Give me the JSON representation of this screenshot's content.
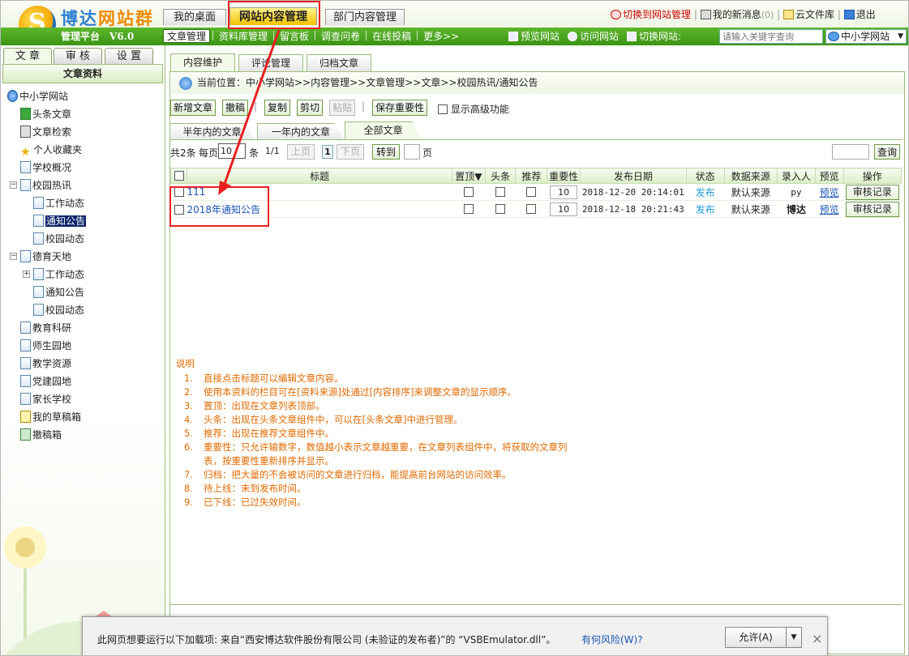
{
  "header": {
    "brand_a": "博达",
    "brand_b": "网站群",
    "platform": "管理平台",
    "version": "V6.0",
    "main_tabs": [
      {
        "label": "我的桌面"
      },
      {
        "label": "网站内容管理"
      },
      {
        "label": "部门内容管理"
      }
    ],
    "links": {
      "switch_manage": "切换到网站管理",
      "messages": "我的新消息",
      "message_count": "(0)",
      "cloud": "云文件库",
      "logout": "退出"
    }
  },
  "submenu": {
    "items": [
      "文章管理",
      "资料库管理",
      "留言板",
      "调查问卷",
      "在线投稿",
      "更多>>"
    ],
    "quick": [
      "预览网站",
      "访问网站",
      "切换网站:"
    ],
    "search_placeholder": "请输入关键字查询",
    "site_select": "中小学网站"
  },
  "left": {
    "tabs": [
      "文 章",
      "审 核",
      "设 置"
    ],
    "title": "文章资料",
    "tree": [
      {
        "label": "中小学网站"
      },
      {
        "label": "头条文章"
      },
      {
        "label": "文章检索"
      },
      {
        "label": "个人收藏夹"
      },
      {
        "label": "学校概况"
      },
      {
        "label": "校园热讯"
      },
      {
        "label": "工作动态"
      },
      {
        "label": "通知公告"
      },
      {
        "label": "校园动态"
      },
      {
        "label": "德育天地"
      },
      {
        "label": "工作动态"
      },
      {
        "label": "通知公告"
      },
      {
        "label": "校园动态"
      },
      {
        "label": "教育科研"
      },
      {
        "label": "师生园地"
      },
      {
        "label": "教学资源"
      },
      {
        "label": "党建园地"
      },
      {
        "label": "家长学校"
      },
      {
        "label": "我的草稿箱"
      },
      {
        "label": "撤稿箱"
      }
    ]
  },
  "content": {
    "tabs": [
      "内容维护",
      "评论管理",
      "归档文章"
    ],
    "breadcrumb": "当前位置：中小学网站>>内容管理>>文章管理>>文章>>校园热讯/通知公告",
    "toolbar": {
      "add": "新增文章",
      "draft": "撤稿",
      "copy": "复制",
      "cut": "剪切",
      "paste": "粘贴",
      "save_importance": "保存重要性",
      "advanced": "显示高级功能"
    },
    "filter_tabs": [
      "半年内的文章",
      "一年内的文章",
      "全部文章"
    ],
    "pager": {
      "total": "共2条",
      "per_page_label": "每页",
      "per_page": "10",
      "unit": "条",
      "page_info": "1/1",
      "prev": "上页",
      "page": "1",
      "next": "下页",
      "goto": "转到",
      "page_unit": "页",
      "query": "查询"
    },
    "table": {
      "headers": [
        "标题",
        "置顶▼",
        "头条",
        "推荐",
        "重要性",
        "发布日期",
        "状态",
        "数据来源",
        "录入人",
        "预览",
        "操作"
      ],
      "rows": [
        {
          "title": "111",
          "importance": "10",
          "date": "2018-12-20 20:14:01",
          "status": "发布",
          "source": "默认来源",
          "author": "py",
          "preview": "预览",
          "action": "审核记录"
        },
        {
          "title": "2018年通知公告",
          "importance": "10",
          "date": "2018-12-18 20:21:43",
          "status": "发布",
          "source": "默认来源",
          "author": "博达",
          "preview": "预览",
          "action": "审核记录"
        }
      ]
    },
    "notes": {
      "title": "说明",
      "items": [
        "直接点击标题可以编辑文章内容。",
        "使用本资料的栏目可在[资料来源]处通过[内容排序]来调整文章的显示顺序。",
        "置顶：出现在文章列表顶部。",
        "头条：出现在头条文章组件中，可以在[头条文章]中进行管理。",
        "推荐：出现在推荐文章组件中。",
        "重要性：只允许输数字，数值越小表示文章越重要，在文章列表组件中，将获取的文章列表，按重要性重新排序并显示。",
        "归档：把大量的不会被访问的文章进行归档，能提高前台网站的访问效率。",
        "待上线：未到发布时间。",
        "已下线：已过失效时间。"
      ],
      "numbers": [
        "1.",
        "2.",
        "3.",
        "4.",
        "5.",
        "6.",
        "7.",
        "8.",
        "9."
      ]
    }
  },
  "notification": {
    "message": "此网页想要运行以下加载项: 来自“西安博达软件股份有限公司 (未验证的发布者)”的 “VSBEmulator.dll”。",
    "risk": "有何风险(W)?",
    "allow": "允许(A)",
    "dropdown": "▼",
    "close": "×"
  },
  "colors": {
    "accent_green": "#3c9414",
    "callout_red": "#e82020",
    "link_blue": "#1b56b5",
    "note_orange": "#e06a00"
  }
}
